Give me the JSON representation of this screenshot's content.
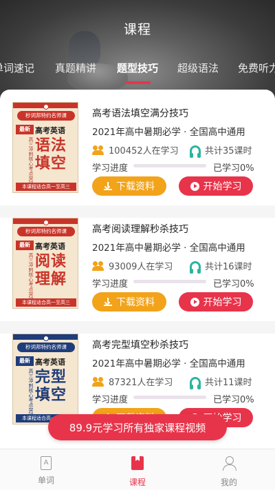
{
  "header": {
    "title": "课程"
  },
  "tabs": [
    {
      "label": "单词速记",
      "active": false
    },
    {
      "label": "真题精讲",
      "active": false
    },
    {
      "label": "题型技巧",
      "active": true
    },
    {
      "label": "超级语法",
      "active": false
    },
    {
      "label": "免费听力",
      "active": false
    }
  ],
  "colors": {
    "accent": "#e8344a",
    "download": "#f2a31a",
    "teal": "#2bb5a0"
  },
  "courses": [
    {
      "title": "高考语法填空满分技巧",
      "subtitle": "2021年高中暑期必学 · 全国高中通用",
      "learners": "100452人在学习",
      "lessons": "共计35课时",
      "progress_label": "学习进度",
      "progress_text": "已学习0%",
      "progress_fraction": 0.0,
      "download_label": "下载资料",
      "start_label": "开始学习",
      "cover": {
        "badge": "秒词邦特约名师课",
        "latest": "最新",
        "subject": "高考英语",
        "big1": "语法",
        "big2": "填空",
        "side": "高三冲刺核心考点突破",
        "footer": "本课程适合高一至高三",
        "theme": "red"
      }
    },
    {
      "title": "高考阅读理解秒杀技巧",
      "subtitle": "2021年高中暑期必学 · 全国高中通用",
      "learners": "93009人在学习",
      "lessons": "共计16课时",
      "progress_label": "学习进度",
      "progress_text": "已学习0%",
      "progress_fraction": 0.0,
      "download_label": "下载资料",
      "start_label": "开始学习",
      "cover": {
        "badge": "秒词邦特约名师课",
        "latest": "最新",
        "subject": "高考英语",
        "big1": "阅读",
        "big2": "理解",
        "side": "高三冲刺核心考点突破",
        "footer": "本课程适合高一至高三",
        "theme": "red"
      }
    },
    {
      "title": "高考完型填空秒杀技巧",
      "subtitle": "2021年高中暑期必学 · 全国高中通用",
      "learners": "87321人在学习",
      "lessons": "共计11课时",
      "progress_label": "学习进度",
      "progress_text": "已学习0%",
      "progress_fraction": 0.0,
      "download_label": "下载资料",
      "start_label": "开始学习",
      "cover": {
        "badge": "秒词邦特约名师课",
        "latest": "最新",
        "subject": "高考英语",
        "big1": "完型",
        "big2": "填空",
        "side": "高三冲刺核心考点突破",
        "footer": "本课程适合高一至高三",
        "theme": "blue"
      }
    }
  ],
  "promo": {
    "label": "89.9元学习所有独家课程视频"
  },
  "bottom_nav": [
    {
      "label": "单词",
      "icon": "book-icon",
      "glyph": "A",
      "active": false
    },
    {
      "label": "课程",
      "icon": "course-icon",
      "glyph": "",
      "active": true
    },
    {
      "label": "我的",
      "icon": "user-icon",
      "glyph": "",
      "active": false
    }
  ]
}
